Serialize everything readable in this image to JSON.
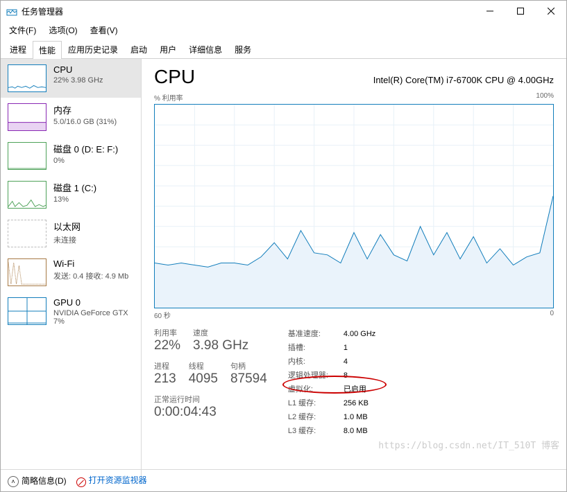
{
  "window": {
    "title": "任务管理器"
  },
  "menu": {
    "file": "文件(F)",
    "options": "选项(O)",
    "view": "查看(V)"
  },
  "tabs": [
    "进程",
    "性能",
    "应用历史记录",
    "启动",
    "用户",
    "详细信息",
    "服务"
  ],
  "sidebar": [
    {
      "name": "CPU",
      "sub": "22% 3.98 GHz",
      "kind": "cpu"
    },
    {
      "name": "内存",
      "sub": "5.0/16.0 GB (31%)",
      "kind": "mem"
    },
    {
      "name": "磁盘 0 (D: E: F:)",
      "sub": "0%",
      "kind": "disk"
    },
    {
      "name": "磁盘 1 (C:)",
      "sub": "13%",
      "kind": "disk"
    },
    {
      "name": "以太网",
      "sub": "未连接",
      "kind": "eth"
    },
    {
      "name": "Wi-Fi",
      "sub": "发送: 0.4  接收: 4.9 Mb",
      "kind": "wifi"
    },
    {
      "name": "GPU 0",
      "sub": "NVIDIA GeForce GTX 7%",
      "kind": "gpu"
    }
  ],
  "detail": {
    "title": "CPU",
    "model": "Intel(R) Core(TM) i7-6700K CPU @ 4.00GHz",
    "axis_label": "% 利用率",
    "axis_max": "100%",
    "x_left": "60 秒",
    "x_right": "0",
    "stats": {
      "util_lbl": "利用率",
      "util_val": "22%",
      "speed_lbl": "速度",
      "speed_val": "3.98 GHz",
      "proc_lbl": "进程",
      "proc_val": "213",
      "thread_lbl": "线程",
      "thread_val": "4095",
      "handle_lbl": "句柄",
      "handle_val": "87594",
      "uptime_lbl": "正常运行时间",
      "uptime_val": "0:00:04:43"
    },
    "specs": {
      "base_k": "基准速度:",
      "base_v": "4.00 GHz",
      "socket_k": "插槽:",
      "socket_v": "1",
      "core_k": "内核:",
      "core_v": "4",
      "lp_k": "逻辑处理器:",
      "lp_v": "8",
      "virt_k": "虚拟化:",
      "virt_v": "已启用",
      "l1_k": "L1 缓存:",
      "l1_v": "256 KB",
      "l2_k": "L2 缓存:",
      "l2_v": "1.0 MB",
      "l3_k": "L3 缓存:",
      "l3_v": "8.0 MB"
    }
  },
  "bottom": {
    "brief": "简略信息(D)",
    "resmon": "打开资源监视器"
  },
  "watermark": "https://blog.csdn.net/IT_510T  博客",
  "chart_data": {
    "type": "line",
    "title": "% 利用率",
    "xlabel": "60 秒 → 0",
    "ylabel": "% 利用率",
    "ylim": [
      0,
      100
    ],
    "x_seconds": [
      60,
      58,
      56,
      54,
      52,
      50,
      48,
      46,
      44,
      42,
      40,
      38,
      36,
      34,
      32,
      30,
      28,
      26,
      24,
      22,
      20,
      18,
      16,
      14,
      12,
      10,
      8,
      6,
      4,
      2,
      0
    ],
    "values": [
      22,
      21,
      22,
      21,
      20,
      22,
      22,
      21,
      25,
      32,
      24,
      38,
      27,
      26,
      22,
      37,
      24,
      36,
      26,
      23,
      40,
      26,
      37,
      24,
      35,
      22,
      29,
      21,
      25,
      27,
      55
    ]
  }
}
